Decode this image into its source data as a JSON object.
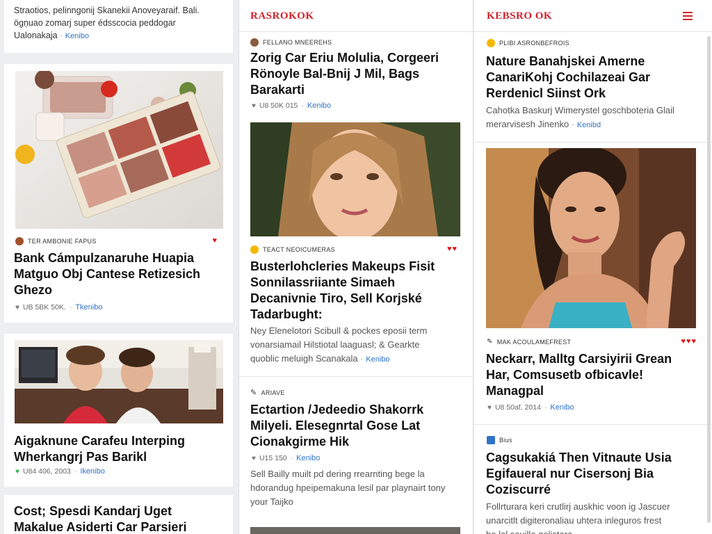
{
  "col1": {
    "top_card": {
      "excerpt1": "Straotios, pelinngonij Skanekii Anoveyaraif. Bali.",
      "excerpt2": "ögņuao zomarj super édsscocia peddogar",
      "excerpt3": "Ualonakaja",
      "link": "Kenibo"
    },
    "card1": {
      "meta": "TER AMBONIE FAPUS",
      "title1": "Bank Cámpulzanaruhe Huapia",
      "title2": "Matguo Obj Cantese Retizesich",
      "title3": "Ghezo",
      "stats": "UB 5BK 50K.",
      "link": "Tkenibo"
    },
    "card2": {
      "title1": "Aigaknune Carafeu Interping",
      "title2": "Wherkangrj Pas Barikl",
      "stats": "U84 406, 2003",
      "link": "Ikenibo"
    },
    "card3": {
      "title1": "Cost; Spesdi Kandarj Uget",
      "title2": "Makalue Asiderti Car Parsieri"
    }
  },
  "col2": {
    "logo": "RASROKOK",
    "card1": {
      "meta": "FELLANO MNEEREHS",
      "title1": "Zorig Car Eriu Molulia, Corgeeri",
      "title2": "Rönoyle Bal-Bnij J Mil, Bags",
      "title3": "Barakarti",
      "stats": "U8 50K 015",
      "link": "Kenibo"
    },
    "card2": {
      "meta": "TEACT NEOICUMERAS",
      "title1": "Busterlohcleries Makeups Fisit",
      "title2": "Sonnilassriiante Simaeh",
      "title3": "Decanivnie Tiro, Sell Korjské",
      "title4": "Tadarbught:",
      "excerpt1": "Ney Elenelotori Scibull & pockes eposii term",
      "excerpt2": "vonarsiamail Hilstiotal laaguasl; & Gearkte",
      "excerpt3": "quoblic meluigh Scanakala",
      "link": "Kenibo"
    },
    "card3": {
      "meta": "ARIAVE",
      "title1": "Ectartion /Jedeedio Shakorrk",
      "title2": "Milyeli. Elesegnrtal Gose Lat",
      "title3": "Cionakgirme Hik",
      "stats": "U15 150",
      "link": "Kenibo",
      "excerpt1": "Sell Bailly muilt pd dering rrearnting bege la",
      "excerpt2": "hdorandug hpeipemakuna lesil par playnairt tony",
      "excerpt3": "your Taijko"
    }
  },
  "col3": {
    "logo": "KEBSRO OK",
    "card1": {
      "meta": "PLIBI ASRONBEFROIS",
      "title1": "Nature Banahjskei Amerne",
      "title2": "CanariKohj Cochilazeai Gar",
      "title3": "Rerdenicl Siinst Ork",
      "excerpt1": "Cahotka Baskurj Wimerystel goschboteria Glail",
      "excerpt2": "merarvisesh Jinenko",
      "link": "Kenibd"
    },
    "card2": {
      "meta": "MAK ACOULAMEFREST",
      "title1": "Neckarr, Malltg Carsiyirii Grean",
      "title2": "Har, Comsusetb ofbicavle!",
      "title3": "Managpal",
      "stats": "U8 50af, 2014",
      "link": "Kenibo"
    },
    "card3": {
      "meta": "Bius",
      "title1": "Cagsukakiá Then Vitnaute Usia",
      "title2": "Egifaueral nur Cisersonj Bia",
      "title3": "Coziscurré",
      "excerpt1": "Follrturara keri crutlirj auskhic voon ig Jascuer",
      "excerpt2": "unarcitlt digiteronaliau uhtera inleguros frest",
      "excerpt3": "be lal seuille golistara"
    }
  },
  "colors": {
    "accent": "#d1202a",
    "link": "#2f73c9"
  }
}
